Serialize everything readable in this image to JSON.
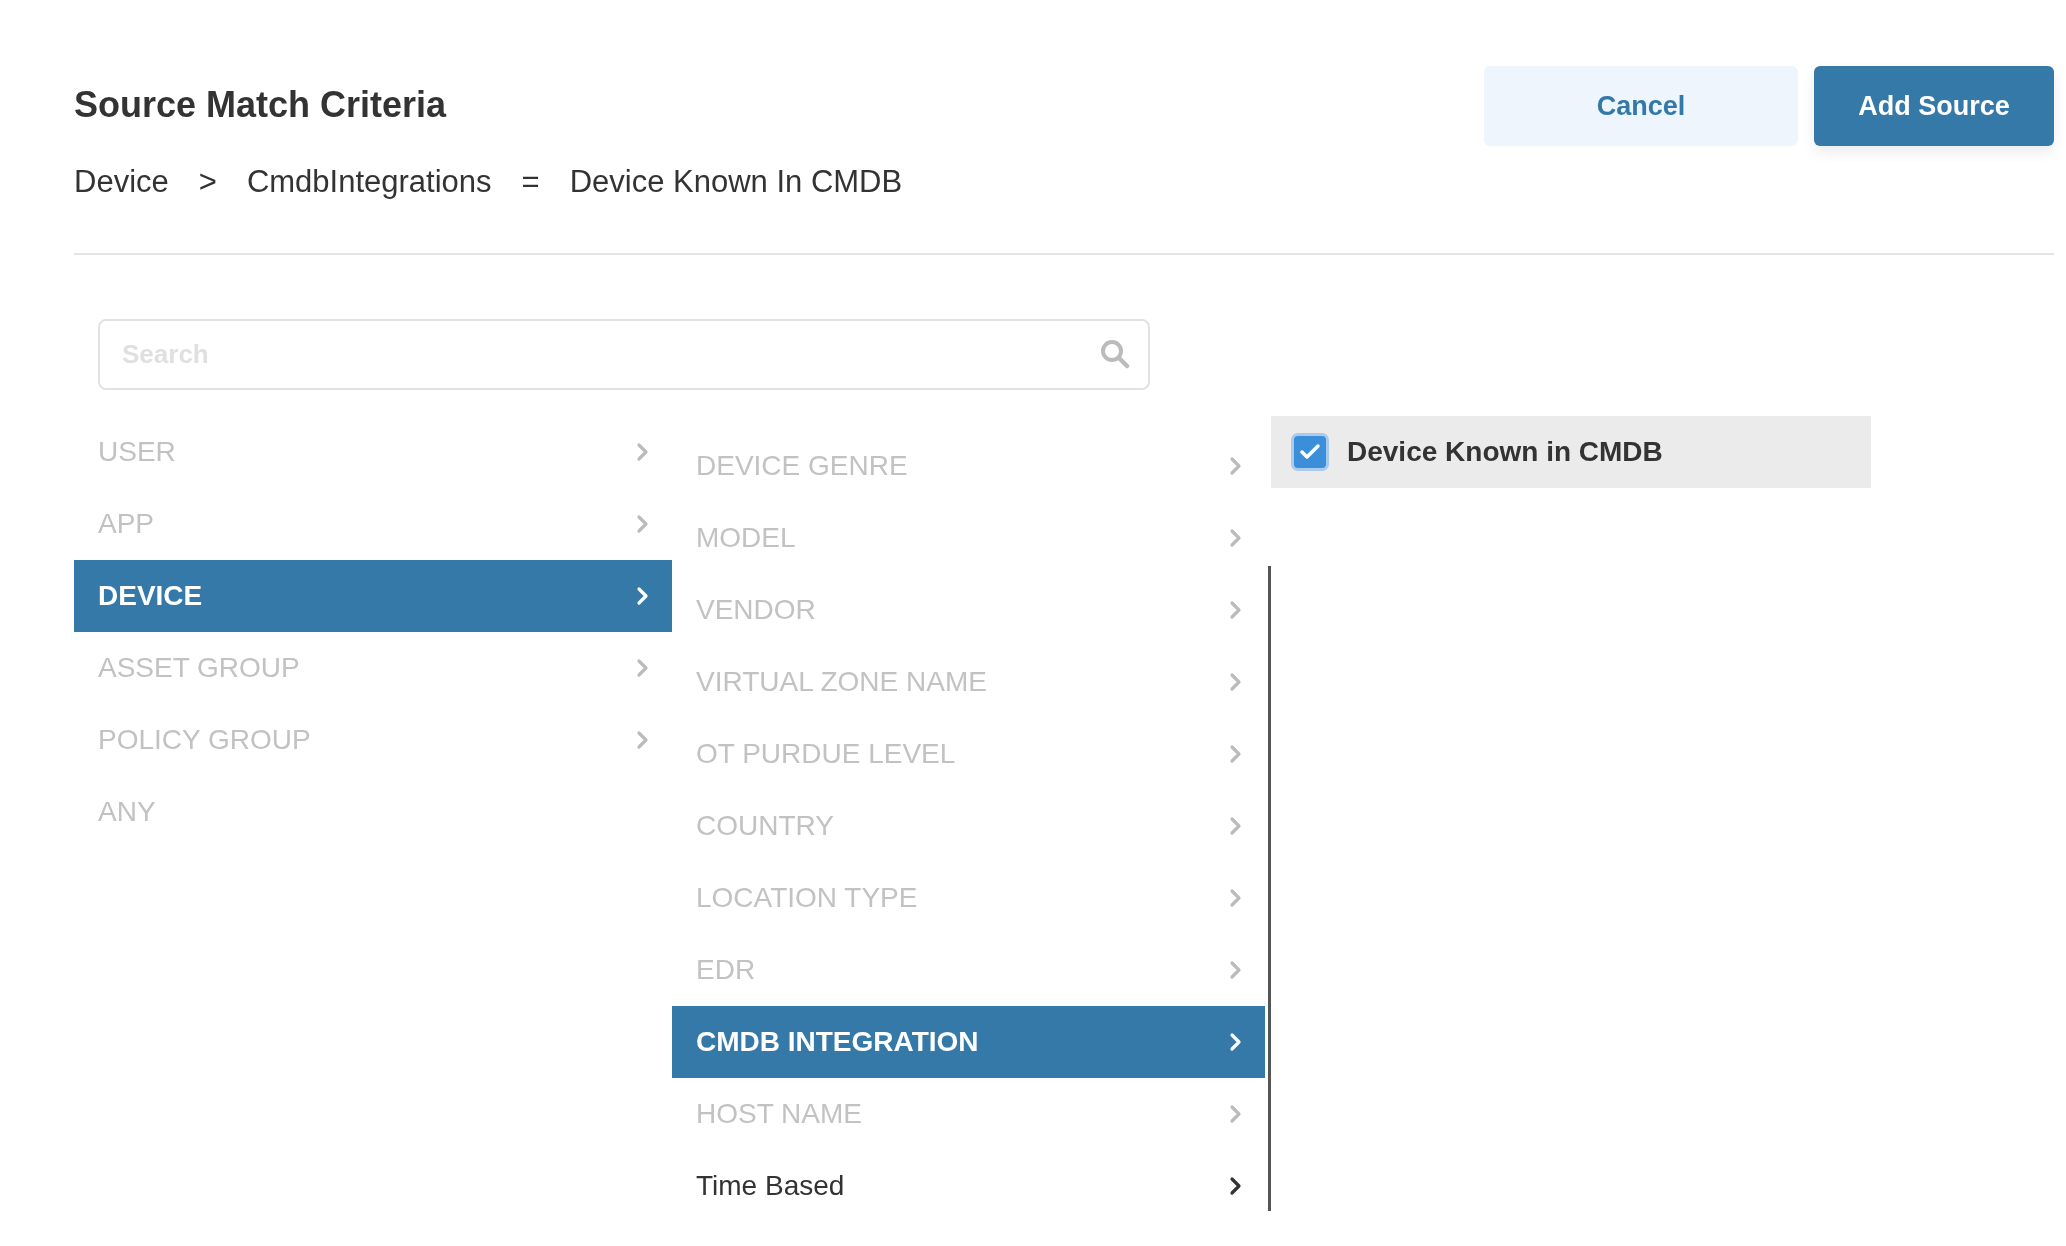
{
  "title": "Source Match Criteria",
  "breadcrumb": {
    "parts": [
      "Device",
      "CmdbIntegrations",
      "Device Known In CMDB"
    ],
    "separators": [
      ">",
      "="
    ]
  },
  "buttons": [
    {
      "label": "Cancel",
      "kind": "secondary"
    },
    {
      "label": "Add Source",
      "kind": "primary"
    }
  ],
  "search": {
    "placeholder": "Search"
  },
  "categories": [
    {
      "label": "USER",
      "selected": false,
      "disabled": true,
      "has_submenu": true
    },
    {
      "label": "APP",
      "selected": false,
      "disabled": true,
      "has_submenu": true
    },
    {
      "label": "DEVICE",
      "selected": true,
      "disabled": false,
      "has_submenu": true
    },
    {
      "label": "ASSET GROUP",
      "selected": false,
      "disabled": true,
      "has_submenu": true
    },
    {
      "label": "POLICY GROUP",
      "selected": false,
      "disabled": true,
      "has_submenu": true
    },
    {
      "label": "ANY",
      "selected": false,
      "disabled": true,
      "has_submenu": false
    }
  ],
  "attributes": [
    {
      "label": "DEVICE GENRE",
      "selected": false,
      "disabled": true,
      "has_submenu": true
    },
    {
      "label": "MODEL",
      "selected": false,
      "disabled": true,
      "has_submenu": true
    },
    {
      "label": "VENDOR",
      "selected": false,
      "disabled": true,
      "has_submenu": true
    },
    {
      "label": "VIRTUAL ZONE NAME",
      "selected": false,
      "disabled": true,
      "has_submenu": true
    },
    {
      "label": "OT PURDUE LEVEL",
      "selected": false,
      "disabled": true,
      "has_submenu": true
    },
    {
      "label": "COUNTRY",
      "selected": false,
      "disabled": true,
      "has_submenu": true
    },
    {
      "label": "LOCATION TYPE",
      "selected": false,
      "disabled": true,
      "has_submenu": true
    },
    {
      "label": "EDR",
      "selected": false,
      "disabled": true,
      "has_submenu": true
    },
    {
      "label": "CMDB INTEGRATION",
      "selected": true,
      "disabled": false,
      "has_submenu": true
    },
    {
      "label": "HOST NAME",
      "selected": false,
      "disabled": true,
      "has_submenu": true
    },
    {
      "label": "Time Based",
      "selected": false,
      "disabled": false,
      "has_submenu": true
    }
  ],
  "values": [
    {
      "label": "Device Known in CMDB",
      "checked": true
    }
  ]
}
